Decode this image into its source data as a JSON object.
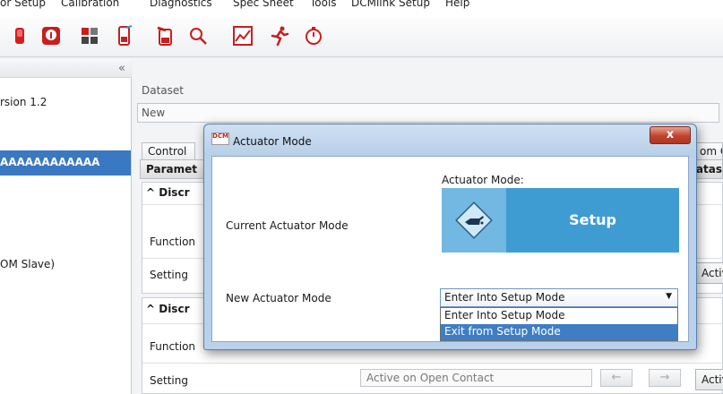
{
  "menubar": {
    "items": [
      "or Setup",
      "Calibration",
      "Diagnostics",
      "Spec Sheet",
      "Tools",
      "DCMlink Setup",
      "Help"
    ]
  },
  "toolbar": {
    "icons": [
      "stop-icon",
      "lock-icon",
      "io-modules-icon",
      "memory-card-icon",
      "test-icon",
      "search-icon",
      "chart-icon",
      "run-icon",
      "timer-icon"
    ]
  },
  "left_panel": {
    "collapse": "«",
    "version_text": "rsion 1.2",
    "selected_text": "AAAAAAAAAAAA",
    "slave_text": "OM Slave)"
  },
  "main": {
    "dataset_label": "Dataset",
    "dataset_value": "New",
    "tab_control": "Control",
    "tab_right": "om C",
    "grid_header_left": "Paramet",
    "grid_header_right": "atas",
    "group1_title": "^  Discr",
    "group2_title": "^  Discr",
    "function_label": "Function",
    "setting_label": "Setting",
    "setting_value": "Active on Open Contact",
    "active_button": "Activ",
    "prev_arrow": "←",
    "next_arrow": "→"
  },
  "dialog": {
    "title": "Actuator Mode",
    "app_icon_text": "DCM",
    "close_label": "x",
    "current_label": "Current Actuator Mode",
    "mode_header": "Actuator Mode:",
    "mode_value": "Setup",
    "new_label": "New Actuator Mode",
    "select_value": "Enter Into Setup Mode",
    "options": [
      "Enter Into Setup Mode",
      "Exit from Setup Mode"
    ],
    "selected_option_index": 1
  },
  "colors": {
    "accent": "#3a78c2",
    "mode_card": "#3f9cd3",
    "close_button": "#c0432d"
  }
}
